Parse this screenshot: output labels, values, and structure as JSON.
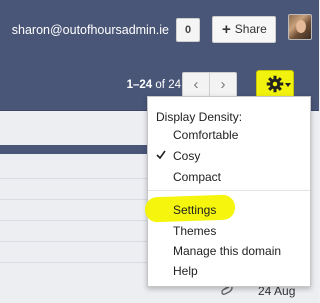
{
  "account": {
    "email": "sharon@outofhoursadmin.ie",
    "notification_count": "0",
    "share_label": "Share",
    "share_icon": "plus-icon",
    "avatar_icon": "profile-photo"
  },
  "toolbar": {
    "pager_range": "1–24",
    "pager_of": "of",
    "pager_total": "24",
    "prev_icon": "chevron-left-icon",
    "next_icon": "chevron-right-icon",
    "settings_icon": "gear-icon",
    "highlight_color": "#f2f20f"
  },
  "menu": {
    "density_heading": "Display Density:",
    "density_options": [
      {
        "label": "Comfortable",
        "selected": false
      },
      {
        "label": "Cosy",
        "selected": true
      },
      {
        "label": "Compact",
        "selected": false
      }
    ],
    "items": [
      {
        "label": "Settings",
        "highlighted": true
      },
      {
        "label": "Themes",
        "highlighted": false
      },
      {
        "label": "Manage this domain",
        "highlighted": false
      },
      {
        "label": "Help",
        "highlighted": false
      }
    ]
  },
  "list": {
    "row_date": "24 Aug",
    "row_icon": "paperclip-icon"
  },
  "colors": {
    "header_bg": "#4a5678",
    "highlight": "#f4f400"
  }
}
